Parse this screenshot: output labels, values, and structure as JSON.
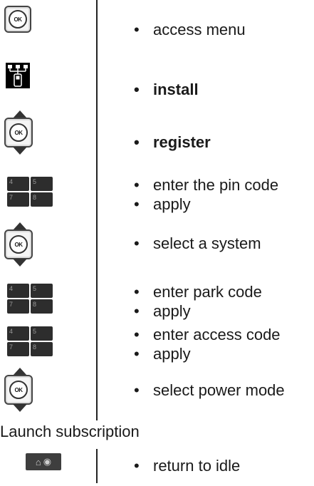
{
  "rows": [
    {
      "icon": "ok-button-icon",
      "items": [
        "access menu"
      ]
    },
    {
      "icon": "network-install-icon",
      "items": [
        "install"
      ]
    },
    {
      "icon": "ok-navigation-icon",
      "items": [
        "register"
      ]
    },
    {
      "icon": "keypad-icon",
      "items": [
        "enter the pin code",
        "apply"
      ]
    },
    {
      "icon": "ok-navigation-icon",
      "items": [
        "select a system"
      ]
    },
    {
      "icon": "keypad-icon",
      "items": [
        "enter park code",
        "apply"
      ]
    },
    {
      "icon": "keypad-icon",
      "items": [
        "enter access code",
        "apply"
      ]
    },
    {
      "icon": "ok-navigation-icon",
      "items": [
        "select power mode"
      ]
    }
  ],
  "ok_label": "OK",
  "keypad_keys": [
    "4",
    "5",
    "7",
    "8"
  ],
  "section_title": "Launch subscription",
  "footer": {
    "icon": "home-button-icon",
    "items": [
      "return to idle"
    ]
  }
}
